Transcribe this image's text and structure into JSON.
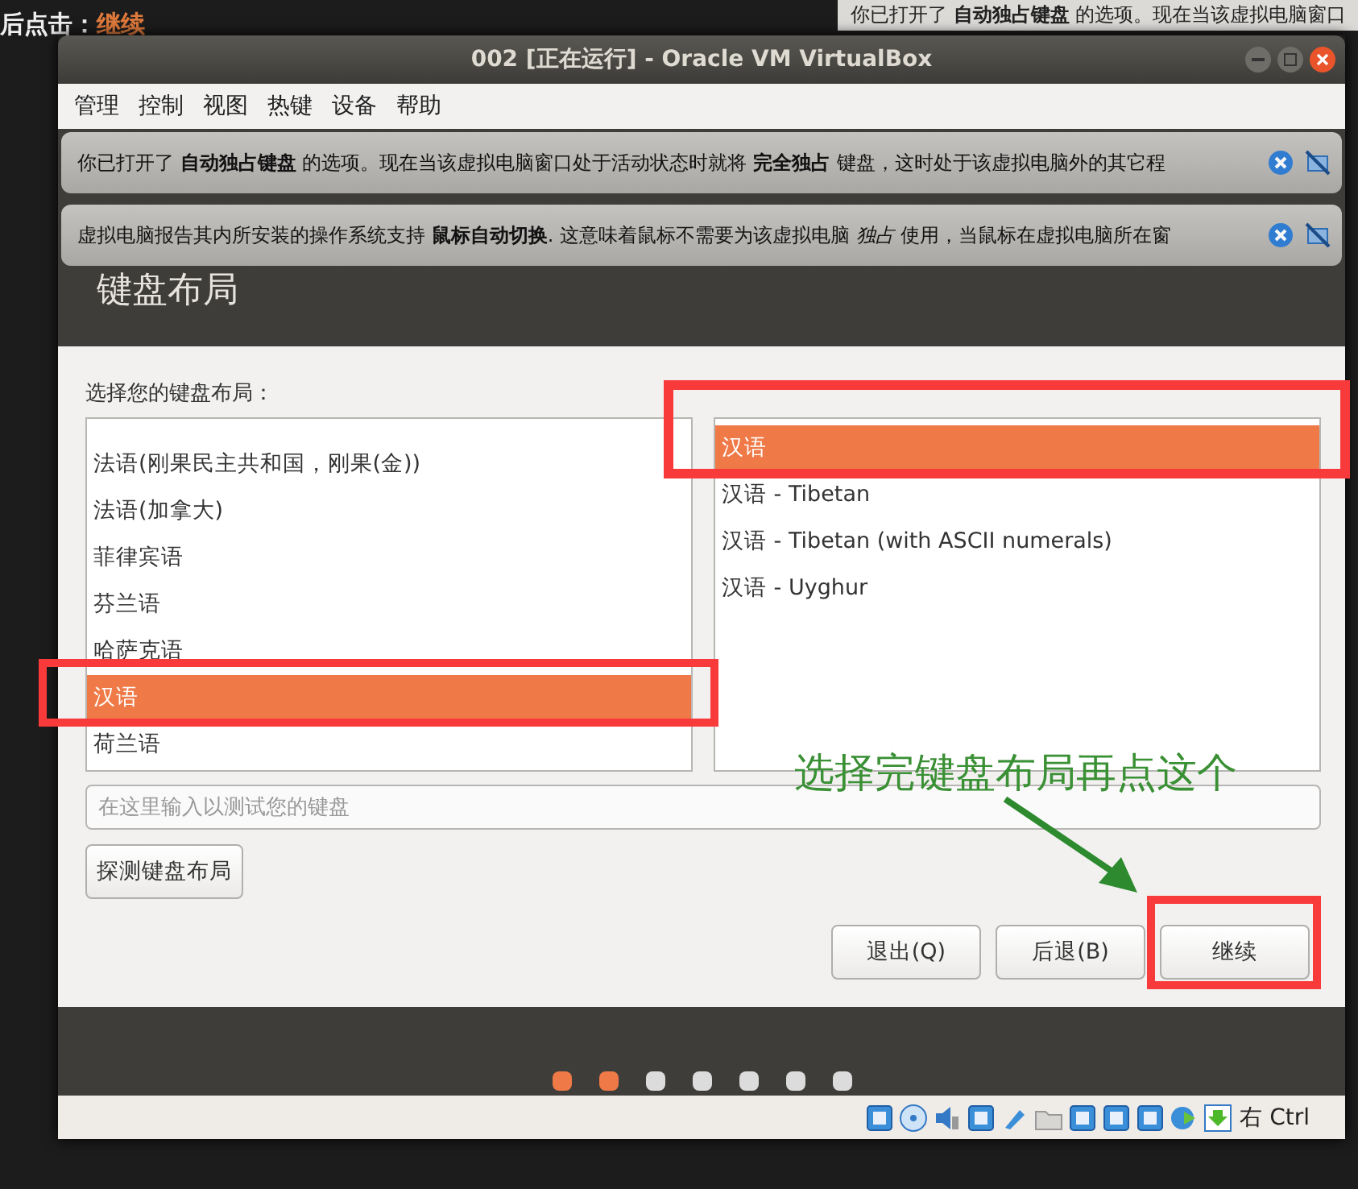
{
  "background": {
    "left_text": "后点击：",
    "left_link": "继续",
    "notice": "你已打开了 **自动独占键盘** 的选项。现在当该虚拟电脑窗口"
  },
  "window": {
    "title": "002 [正在运行] - Oracle VM VirtualBox"
  },
  "menu": [
    "管理",
    "控制",
    "视图",
    "热键",
    "设备",
    "帮助"
  ],
  "notifications": [
    {
      "text": "你已打开了 **自动独占键盘** 的选项。现在当该虚拟电脑窗口处于活动状态时就将 **完全独占** 键盘，这时处于该虚拟电脑外的其它程"
    },
    {
      "text": "虚拟电脑报告其内所安装的操作系统支持 **鼠标自动切换**. 这意味着鼠标不需要为该虚拟电脑 *独占* 使用，当鼠标在虚拟电脑所在窗"
    }
  ],
  "installer": {
    "title": "键盘布局",
    "prompt": "选择您的键盘布局：",
    "layouts": [
      {
        "label": "法语(刚果民主共和国，刚果(金))",
        "selected": false
      },
      {
        "label": "法语(加拿大)",
        "selected": false
      },
      {
        "label": "菲律宾语",
        "selected": false
      },
      {
        "label": "芬兰语",
        "selected": false
      },
      {
        "label": "哈萨克语",
        "selected": false
      },
      {
        "label": "汉语",
        "selected": true
      },
      {
        "label": "荷兰语",
        "selected": false
      }
    ],
    "variants": [
      {
        "label": "汉语",
        "selected": true
      },
      {
        "label": "汉语 - Tibetan",
        "selected": false
      },
      {
        "label": "汉语 - Tibetan (with ASCII numerals)",
        "selected": false
      },
      {
        "label": "汉语 - Uyghur",
        "selected": false
      }
    ],
    "test_field": {
      "placeholder": "在这里输入以测试您的键盘"
    },
    "detect_button": "探测键盘布局",
    "buttons": [
      "退出(Q)",
      "后退(B)",
      "继续"
    ]
  },
  "steps": [
    {
      "done": true
    },
    {
      "done": true
    },
    {
      "done": false
    },
    {
      "done": false
    },
    {
      "done": false
    },
    {
      "done": false
    },
    {
      "done": false
    }
  ],
  "status_bar": {
    "host_key": "右 Ctrl"
  },
  "annotation": {
    "text": "选择完键盘布局再点这个"
  }
}
